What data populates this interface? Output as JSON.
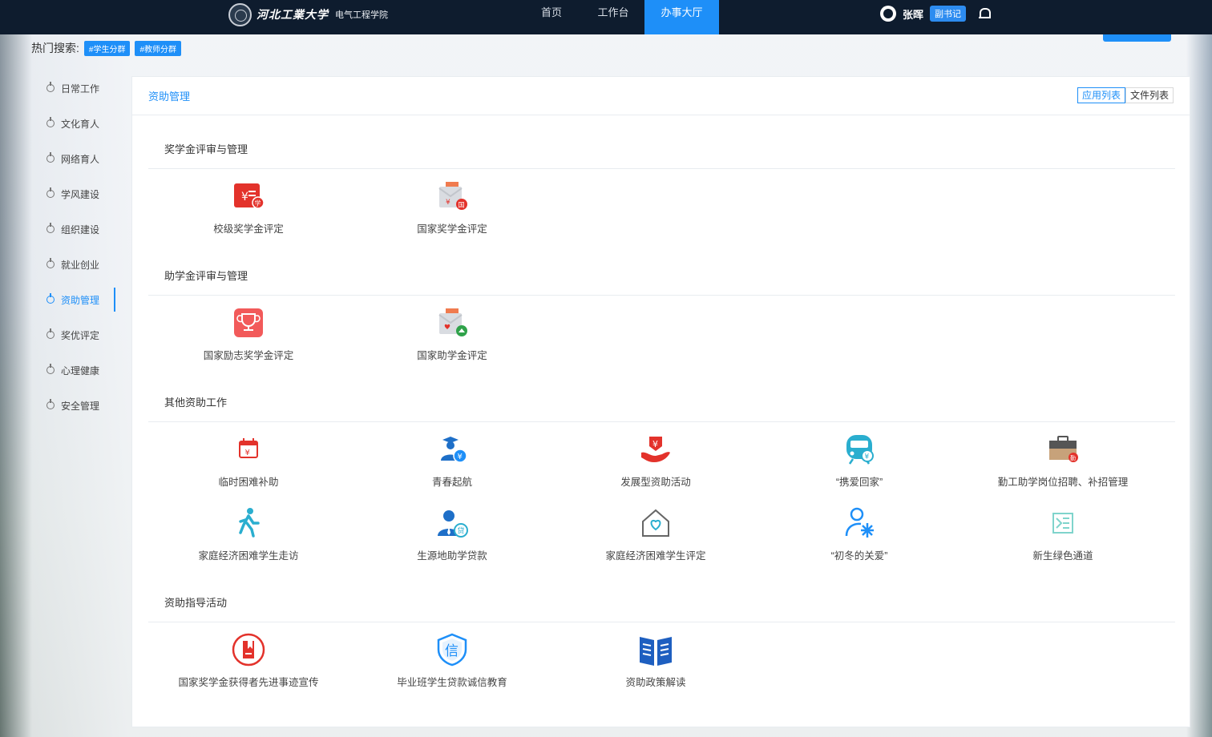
{
  "header": {
    "university_name": "河北工業大学",
    "college_name": "电气工程学院",
    "nav": [
      "首页",
      "工作台",
      "办事大厅"
    ],
    "active_nav": "办事大厅",
    "user_name": "张晖",
    "user_role": "副书记"
  },
  "hot_search": {
    "label": "热门搜索:",
    "tags": [
      "#学生分群",
      "#教师分群"
    ]
  },
  "sidebar": {
    "items": [
      "日常工作",
      "文化育人",
      "网络育人",
      "学风建设",
      "组织建设",
      "就业创业",
      "资助管理",
      "奖优评定",
      "心理健康",
      "安全管理"
    ],
    "active": "资助管理"
  },
  "main": {
    "title": "资助管理",
    "view_switch": [
      "应用列表",
      "文件列表"
    ],
    "active_view": "应用列表",
    "sections": [
      {
        "title": "奖学金评审与管理",
        "apps": [
          {
            "label": "校级奖学金评定",
            "icon": "yuan-scholarship-icon"
          },
          {
            "label": "国家奖学金评定",
            "icon": "national-scholarship-icon"
          }
        ]
      },
      {
        "title": "助学金评审与管理",
        "apps": [
          {
            "label": "国家励志奖学金评定",
            "icon": "trophy-icon"
          },
          {
            "label": "国家助学金评定",
            "icon": "grant-envelope-icon"
          }
        ]
      },
      {
        "title": "其他资助工作",
        "apps": [
          {
            "label": "临时困难补助",
            "icon": "calendar-yuan-icon"
          },
          {
            "label": "青春起航",
            "icon": "graduate-yuan-icon"
          },
          {
            "label": "发展型资助活动",
            "icon": "hand-yuan-icon"
          },
          {
            "label": "“携爱回家”",
            "icon": "train-icon"
          },
          {
            "label": "勤工助学岗位招聘、补招管理",
            "icon": "briefcase-icon"
          },
          {
            "label": "家庭经济困难学生走访",
            "icon": "walking-person-icon"
          },
          {
            "label": "生源地助学贷款",
            "icon": "loan-person-icon"
          },
          {
            "label": "家庭经济困难学生评定",
            "icon": "house-heart-icon"
          },
          {
            "label": "“初冬的关爱”",
            "icon": "person-snowflake-icon"
          },
          {
            "label": "新生绿色通道",
            "icon": "green-channel-icon"
          }
        ]
      },
      {
        "title": "资助指导活动",
        "apps": [
          {
            "label": "国家奖学金获得者先进事迹宣传",
            "icon": "bookmark-circle-icon"
          },
          {
            "label": "毕业班学生贷款诚信教育",
            "icon": "integrity-shield-icon"
          },
          {
            "label": "资助政策解读",
            "icon": "open-book-icon"
          }
        ]
      }
    ]
  },
  "colors": {
    "topbar": "#0e1c2e",
    "accent": "#1e8ff8",
    "red": "#e3322b",
    "blue": "#1e7fd6",
    "cyan": "#2aaecf"
  },
  "icons": {
    "yuan_symbol": "¥",
    "xue_badge": "学",
    "guo_badge": "国",
    "qin_badge": "勤",
    "dai_badge": "贷",
    "xin_char": "信"
  }
}
